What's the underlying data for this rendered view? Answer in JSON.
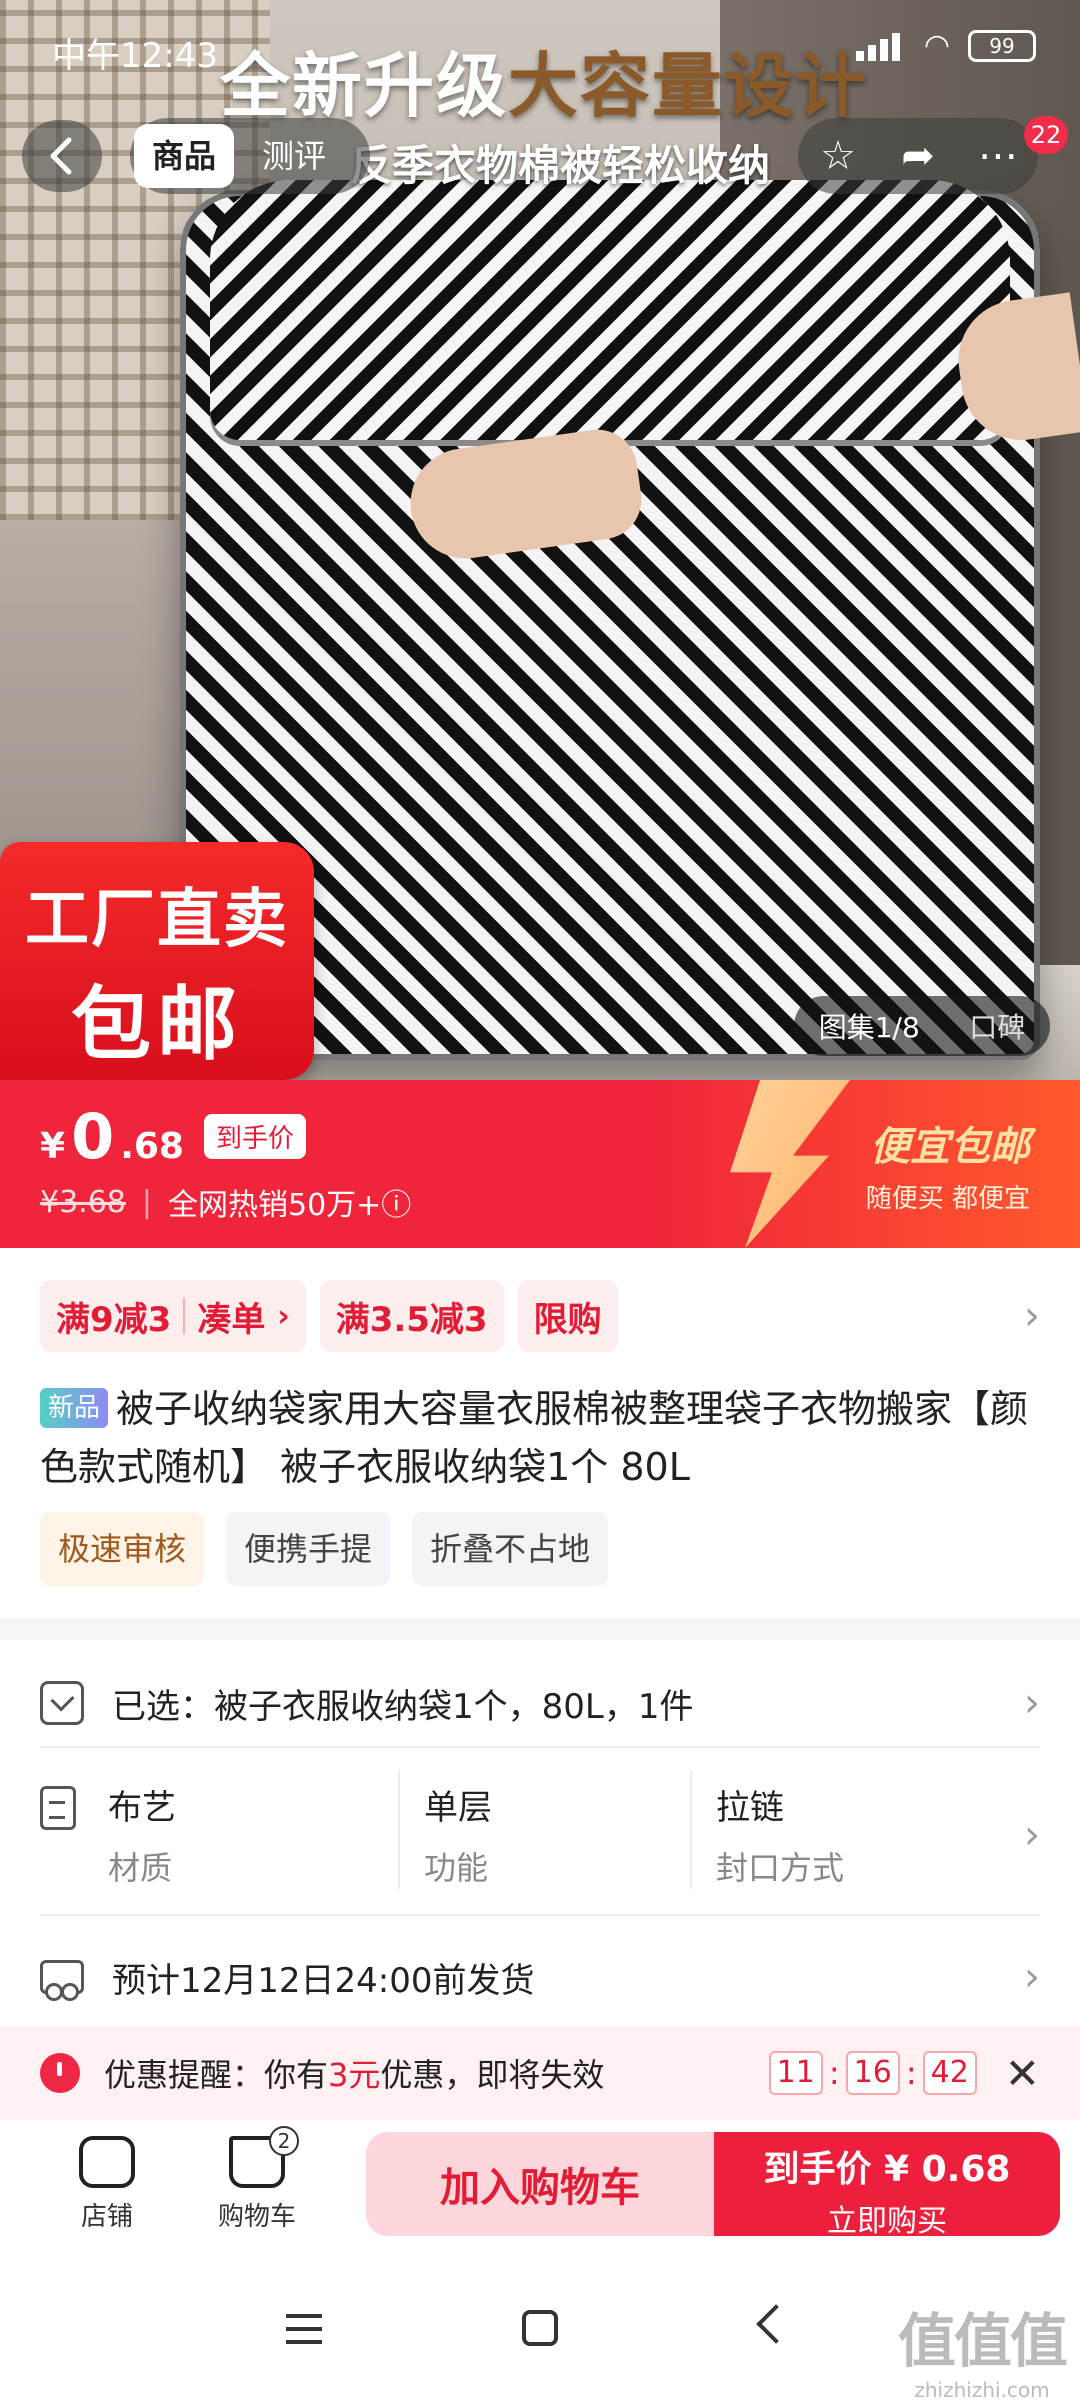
{
  "status_bar": {
    "time": "中午12:43",
    "battery": "99"
  },
  "hero": {
    "headline_white": "全新升级",
    "headline_accent": "大容量设计",
    "subline": "反季衣物棉被轻松收纳",
    "sticker_line1": "工厂直卖",
    "sticker_line2": "包邮",
    "gallery_label": "图集1/8",
    "reviews_label": "口碑"
  },
  "nav": {
    "tabs": [
      {
        "label": "商品",
        "active": true
      },
      {
        "label": "测评",
        "active": false
      }
    ],
    "notification_count": "22"
  },
  "price": {
    "currency": "¥",
    "integer": "0",
    "decimal": ".68",
    "tag": "到手价",
    "original": "¥3.68",
    "sales": "全网热销50万+ⓘ",
    "promo_title": "便宜包邮",
    "promo_sub": "随便买 都便宜"
  },
  "coupons": [
    {
      "main": "满9减3",
      "extra": "凑单"
    },
    {
      "main": "满3.5减3"
    },
    {
      "main": "限购"
    }
  ],
  "product": {
    "new_badge": "新品",
    "title": "被子收纳袋家用大容量衣服棉被整理袋子衣物搬家【颜色款式随机】 被子衣服收纳袋1个 80L",
    "feature_tags": [
      "极速审核",
      "便携手提",
      "折叠不占地"
    ]
  },
  "selected": {
    "label": "已选：被子衣服收纳袋1个，80L，1件"
  },
  "attributes": [
    {
      "value": "布艺",
      "key": "材质"
    },
    {
      "value": "单层",
      "key": "功能"
    },
    {
      "value": "拉链",
      "key": "封口方式"
    }
  ],
  "shipping": {
    "text": "预计12月12日24:00前发货"
  },
  "reminder": {
    "prefix": "优惠提醒：你有",
    "amount": "3元",
    "suffix": "优惠，即将失效",
    "hours": "11",
    "minutes": "16",
    "seconds": "42"
  },
  "bottom_bar": {
    "store_label": "店铺",
    "cart_label": "购物车",
    "cart_count": "2",
    "add_to_cart": "加入购物车",
    "buy_price": "到手价 ¥ 0.68",
    "buy_now": "立即购买"
  },
  "watermark": {
    "big": "值值值",
    "small": "zhizhizhi.com"
  },
  "colors": {
    "brand_red": "#ee1f3c",
    "coupon_bg": "#fdeeee",
    "accent_brown": "#8b5a2b"
  }
}
